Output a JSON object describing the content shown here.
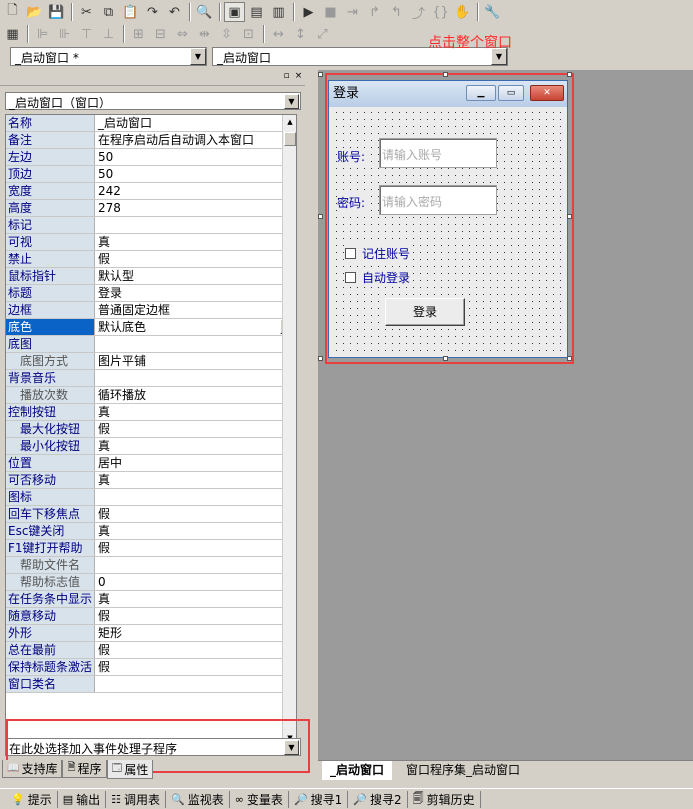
{
  "hint": {
    "text": "点击整个窗口",
    "color": "#ff2a2a"
  },
  "toolbar_row1": [
    {
      "name": "new-file-icon",
      "glyph": "🗋"
    },
    {
      "name": "open-folder-icon",
      "glyph": "📂"
    },
    {
      "name": "save-icon",
      "glyph": "💾"
    },
    {
      "sep": true
    },
    {
      "name": "cut-icon",
      "glyph": "✂"
    },
    {
      "name": "copy-icon",
      "glyph": "⧉"
    },
    {
      "name": "paste-icon",
      "glyph": "📋"
    },
    {
      "name": "redo-icon",
      "glyph": "↷"
    },
    {
      "name": "undo-icon",
      "glyph": "↶"
    },
    {
      "sep": true
    },
    {
      "name": "find-icon",
      "glyph": "🔍"
    },
    {
      "sep": true
    },
    {
      "name": "layout-full-icon",
      "glyph": "▣",
      "pressed": true
    },
    {
      "name": "layout-top-icon",
      "glyph": "▤"
    },
    {
      "name": "layout-left-icon",
      "glyph": "▥"
    },
    {
      "sep": true
    },
    {
      "name": "run-icon",
      "glyph": "▶"
    },
    {
      "name": "stop-icon",
      "glyph": "■",
      "dis": true
    },
    {
      "name": "step-into-icon",
      "glyph": "⇥",
      "dis": true
    },
    {
      "name": "step-over-icon",
      "glyph": "↱",
      "dis": true
    },
    {
      "name": "step-out-icon",
      "glyph": "↰",
      "dis": true
    },
    {
      "name": "run-to-cursor-icon",
      "glyph": "⤴",
      "dis": true
    },
    {
      "name": "breakpoint-icon",
      "glyph": "{}",
      "dis": true
    },
    {
      "name": "hand-icon",
      "glyph": "✋",
      "dis": true
    },
    {
      "sep": true
    },
    {
      "name": "debug-tool-icon",
      "glyph": "🔧"
    }
  ],
  "toolbar_row2": [
    {
      "name": "grid-icon",
      "glyph": "▦"
    },
    {
      "sep": true
    },
    {
      "name": "align-left-icon",
      "glyph": "⊫",
      "dis": true
    },
    {
      "name": "align-right-icon",
      "glyph": "⊪",
      "dis": true
    },
    {
      "name": "align-top-icon",
      "glyph": "⊤",
      "dis": true
    },
    {
      "name": "align-bottom-icon",
      "glyph": "⊥",
      "dis": true
    },
    {
      "sep": true
    },
    {
      "name": "center-h-icon",
      "glyph": "⊞",
      "dis": true
    },
    {
      "name": "center-v-icon",
      "glyph": "⊟",
      "dis": true
    },
    {
      "name": "same-width-icon",
      "glyph": "⇔",
      "dis": true
    },
    {
      "name": "spacing-h-icon",
      "glyph": "⇹",
      "dis": true
    },
    {
      "name": "spacing-v-icon",
      "glyph": "⇳",
      "dis": true
    },
    {
      "name": "tile-icon",
      "glyph": "⊡",
      "dis": true
    },
    {
      "sep": true
    },
    {
      "name": "width-icon",
      "glyph": "↔",
      "dis": true
    },
    {
      "name": "height-icon",
      "glyph": "↕",
      "dis": true
    },
    {
      "name": "size-both-icon",
      "glyph": "⤢",
      "dis": true
    }
  ],
  "combo_left": "_启动窗口 *",
  "combo_right": "_启动窗口",
  "object_combo": "_启动窗口（窗口）",
  "properties": [
    {
      "k": "名称",
      "v": "_启动窗口"
    },
    {
      "k": "备注",
      "v": "在程序启动后自动调入本窗口"
    },
    {
      "k": "左边",
      "v": "50"
    },
    {
      "k": "顶边",
      "v": "50"
    },
    {
      "k": "宽度",
      "v": "242"
    },
    {
      "k": "高度",
      "v": "278"
    },
    {
      "k": "标记",
      "v": ""
    },
    {
      "k": "可视",
      "v": "真"
    },
    {
      "k": "禁止",
      "v": "假"
    },
    {
      "k": "鼠标指针",
      "v": "默认型"
    },
    {
      "k": "标题",
      "v": "登录"
    },
    {
      "k": "边框",
      "v": "普通固定边框"
    },
    {
      "k": "底色",
      "v": "默认底色",
      "sel": true,
      "dropdown": true
    },
    {
      "k": "底图",
      "v": ""
    },
    {
      "k": "底图方式",
      "v": "图片平铺",
      "ind": true,
      "gray": true
    },
    {
      "k": "背景音乐",
      "v": ""
    },
    {
      "k": "播放次数",
      "v": "循环播放",
      "ind": true,
      "gray": true
    },
    {
      "k": "控制按钮",
      "v": "真"
    },
    {
      "k": "最大化按钮",
      "v": "假",
      "ind": true
    },
    {
      "k": "最小化按钮",
      "v": "真",
      "ind": true
    },
    {
      "k": "位置",
      "v": "居中"
    },
    {
      "k": "可否移动",
      "v": "真"
    },
    {
      "k": "图标",
      "v": ""
    },
    {
      "k": "回车下移焦点",
      "v": "假"
    },
    {
      "k": "Esc键关闭",
      "v": "真"
    },
    {
      "k": "F1键打开帮助",
      "v": "假"
    },
    {
      "k": "帮助文件名",
      "v": "",
      "ind": true,
      "gray": true
    },
    {
      "k": "帮助标志值",
      "v": "0",
      "ind": true,
      "gray": true
    },
    {
      "k": "在任务条中显示",
      "v": "真"
    },
    {
      "k": "随意移动",
      "v": "假"
    },
    {
      "k": "外形",
      "v": "矩形"
    },
    {
      "k": "总在最前",
      "v": "假"
    },
    {
      "k": "保持标题条激活",
      "v": "假"
    },
    {
      "k": "窗口类名",
      "v": ""
    }
  ],
  "event_combo": "在此处选择加入事件处理子程序",
  "left_tabs": [
    {
      "label": "支持库",
      "icon": "book-icon",
      "glyph": "📖"
    },
    {
      "label": "程序",
      "icon": "program-icon",
      "glyph": "🗎"
    },
    {
      "label": "属性",
      "icon": "property-icon",
      "glyph": "🗔",
      "active": true
    }
  ],
  "design_window": {
    "title": "登录",
    "account_label": "账号:",
    "account_placeholder": "请输入账号",
    "password_label": "密码:",
    "password_placeholder": "请输入密码",
    "remember": "记住账号",
    "autologin": "自动登录",
    "login_button": "登录"
  },
  "designer_tabs": [
    {
      "label": "_启动窗口",
      "active": true
    },
    {
      "label": "窗口程序集_启动窗口"
    }
  ],
  "statusbar": [
    {
      "label": "提示",
      "icon": "hint-icon",
      "glyph": "💡"
    },
    {
      "label": "输出",
      "icon": "output-icon",
      "glyph": "▤"
    },
    {
      "label": "调用表",
      "icon": "callstack-icon",
      "glyph": "☷"
    },
    {
      "label": "监视表",
      "icon": "watch-icon",
      "glyph": "🔍"
    },
    {
      "label": "变量表",
      "icon": "variables-icon",
      "glyph": "∞"
    },
    {
      "label": "搜寻1",
      "icon": "search1-icon",
      "glyph": "🔎"
    },
    {
      "label": "搜寻2",
      "icon": "search2-icon",
      "glyph": "🔎"
    },
    {
      "label": "剪辑历史",
      "icon": "clip-history-icon",
      "glyph": "🗐"
    }
  ]
}
